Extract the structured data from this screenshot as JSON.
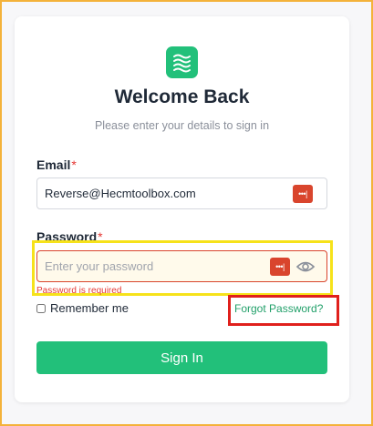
{
  "header": {
    "logo_icon": "wave-lines-icon",
    "title": "Welcome Back",
    "subtitle": "Please enter your details to sign in"
  },
  "email": {
    "label": "Email",
    "required_mark": "*",
    "value": "Reverse@Hecmtoolbox.com",
    "password_manager_icon": "password-manager-icon"
  },
  "password": {
    "label": "Password",
    "required_mark": "*",
    "placeholder": "Enter your password",
    "error": "Password is required",
    "password_manager_icon": "password-manager-icon",
    "visibility_icon": "eye-icon"
  },
  "options": {
    "remember_label": "Remember me",
    "remember_checked": false,
    "forgot_label": "Forgot Password?"
  },
  "actions": {
    "signin_label": "Sign In"
  },
  "colors": {
    "accent": "#22c07a",
    "error": "#e53935",
    "pm_icon": "#d9452d",
    "highlight_yellow": "#f6e21a",
    "highlight_red": "#e0201c",
    "outer_border": "#f4b23a"
  }
}
